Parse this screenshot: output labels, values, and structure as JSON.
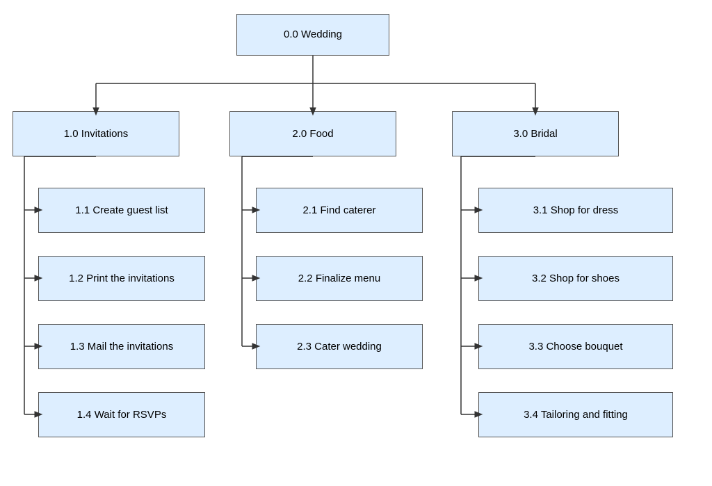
{
  "nodes": {
    "root": {
      "label": "0.0 Wedding"
    },
    "n10": {
      "label": "1.0 Invitations"
    },
    "n20": {
      "label": "2.0 Food"
    },
    "n30": {
      "label": "3.0 Bridal"
    },
    "n11": {
      "label": "1.1 Create guest list"
    },
    "n12": {
      "label": "1.2 Print the invitations"
    },
    "n13": {
      "label": "1.3 Mail the invitations"
    },
    "n14": {
      "label": "1.4 Wait for RSVPs"
    },
    "n21": {
      "label": "2.1 Find caterer"
    },
    "n22": {
      "label": "2.2 Finalize menu"
    },
    "n23": {
      "label": "2.3 Cater wedding"
    },
    "n31": {
      "label": "3.1 Shop for dress"
    },
    "n32": {
      "label": "3.2 Shop for shoes"
    },
    "n33": {
      "label": "3.3 Choose bouquet"
    },
    "n34": {
      "label": "3.4 Tailoring and fitting"
    }
  }
}
